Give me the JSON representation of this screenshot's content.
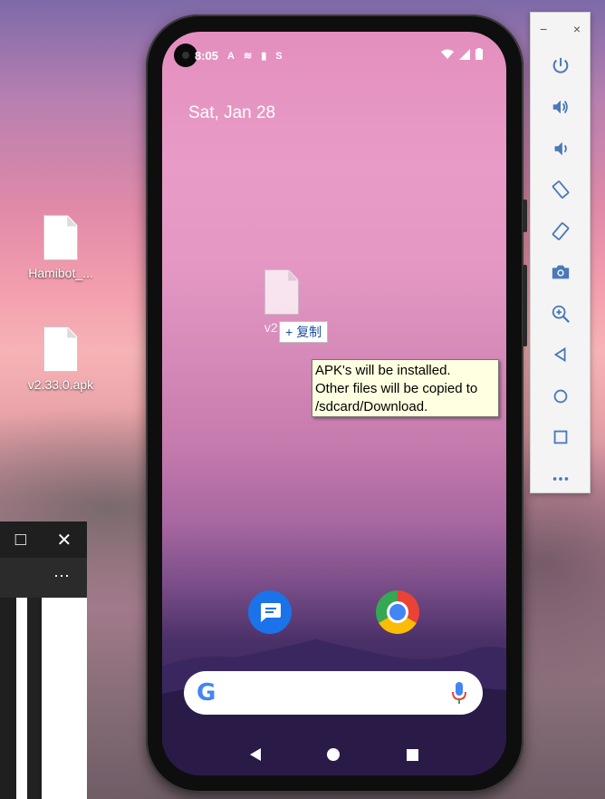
{
  "desktop": {
    "icons": [
      {
        "label": "Hamibot_..."
      },
      {
        "label": "v2.33.0.apk"
      }
    ]
  },
  "side_window": {
    "maximize_glyph": "□",
    "close_glyph": "✕",
    "more_glyph": "⋯"
  },
  "phone": {
    "status": {
      "time": "8:05",
      "icons_left": [
        "A",
        "≋",
        "▮",
        "S"
      ],
      "icons_right": [
        "wifi-icon",
        "signal-icon",
        "battery-icon"
      ]
    },
    "date": "Sat, Jan 28",
    "dragged_file": {
      "label": "v2.33."
    },
    "copy_badge": {
      "plus": "+",
      "label": "复制"
    },
    "dock": [
      {
        "name": "Messages"
      },
      {
        "name": "Chrome"
      }
    ],
    "search": {
      "logo": "G"
    }
  },
  "tooltip": {
    "lines": [
      "APK's will be installed.",
      "Other files will be copied to",
      "/sdcard/Download."
    ]
  },
  "toolbar": {
    "minimize": "−",
    "close": "×",
    "buttons": [
      "power",
      "volume-up",
      "volume-down",
      "rotate-left",
      "rotate-right",
      "screenshot",
      "zoom",
      "back",
      "home",
      "overview",
      "more"
    ]
  },
  "colors": {
    "tooltip_bg": "#ffffe1",
    "accent_blue": "#1a73e8",
    "copy_text": "#1a4fa0"
  }
}
